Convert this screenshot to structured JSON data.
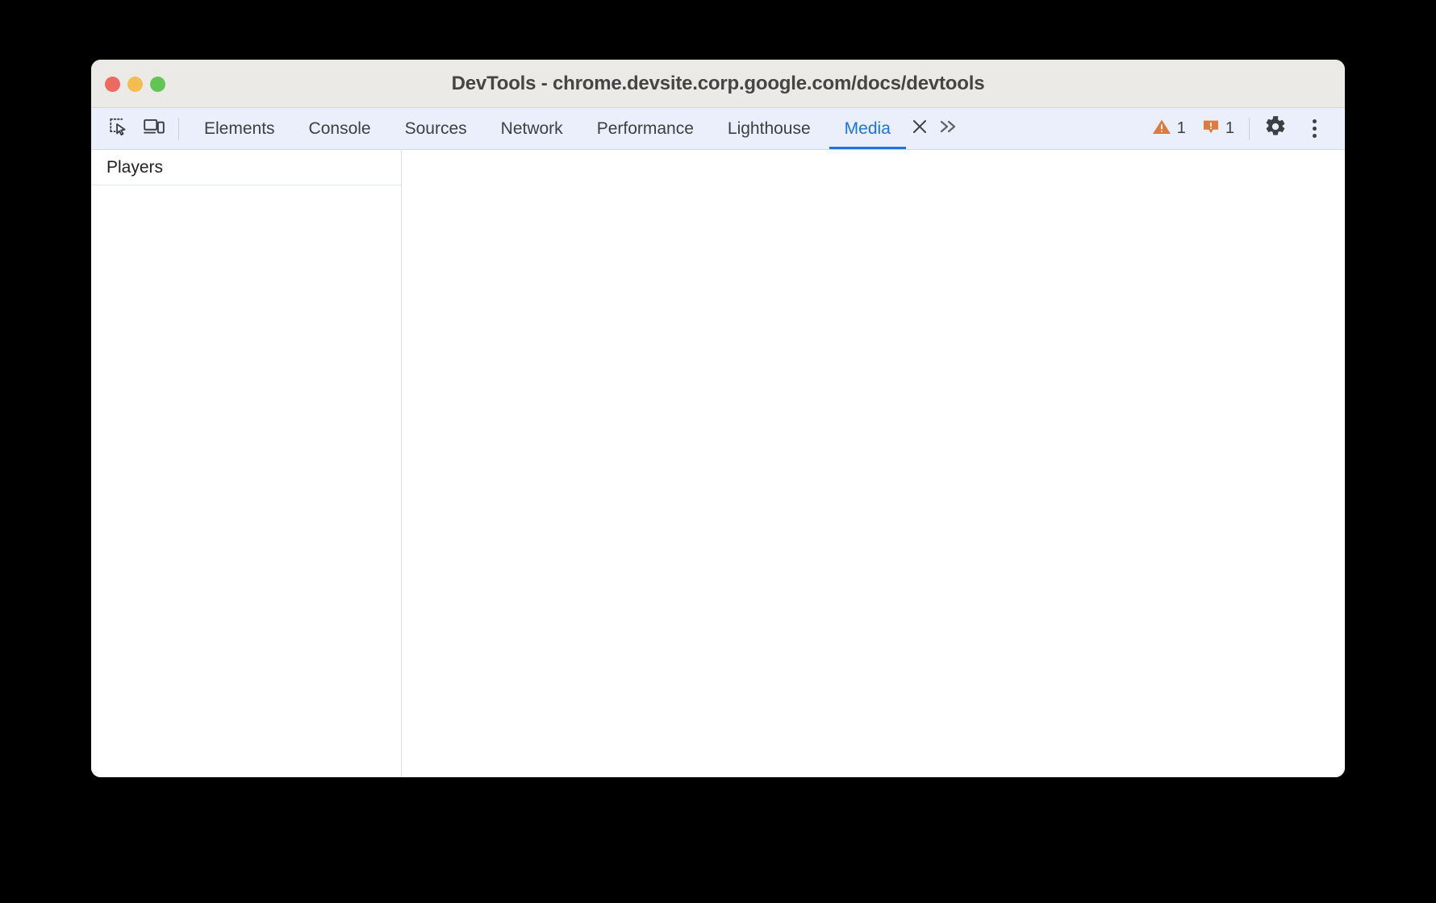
{
  "window": {
    "title": "DevTools - chrome.devsite.corp.google.com/docs/devtools",
    "traffic_lights": {
      "close_label": "close",
      "minimize_label": "minimize",
      "maximize_label": "maximize"
    }
  },
  "toolbar": {
    "inspect_icon": "inspect-element-icon",
    "device_icon": "device-toolbar-icon",
    "tabs": [
      {
        "label": "Elements",
        "active": false
      },
      {
        "label": "Console",
        "active": false
      },
      {
        "label": "Sources",
        "active": false
      },
      {
        "label": "Network",
        "active": false
      },
      {
        "label": "Performance",
        "active": false
      },
      {
        "label": "Lighthouse",
        "active": false
      },
      {
        "label": "Media",
        "active": true
      }
    ],
    "close_tab_icon": "close-icon",
    "overflow_icon": "chevron-double-right-icon",
    "warnings": {
      "icon": "warning-triangle-icon",
      "count": "1",
      "color": "#e07a3c"
    },
    "issues": {
      "icon": "issue-bubble-icon",
      "count": "1",
      "color": "#e07a3c"
    },
    "settings_icon": "gear-icon",
    "more_icon": "kebab-menu-icon"
  },
  "media_panel": {
    "sidebar": {
      "header": "Players",
      "items": []
    },
    "content": {
      "empty": ""
    }
  },
  "colors": {
    "accent": "#1a73e8",
    "toolbar_bg": "#eaeffb",
    "titlebar_bg": "#eceae7",
    "text": "#3c4043",
    "desktop_bg": "#000000"
  }
}
